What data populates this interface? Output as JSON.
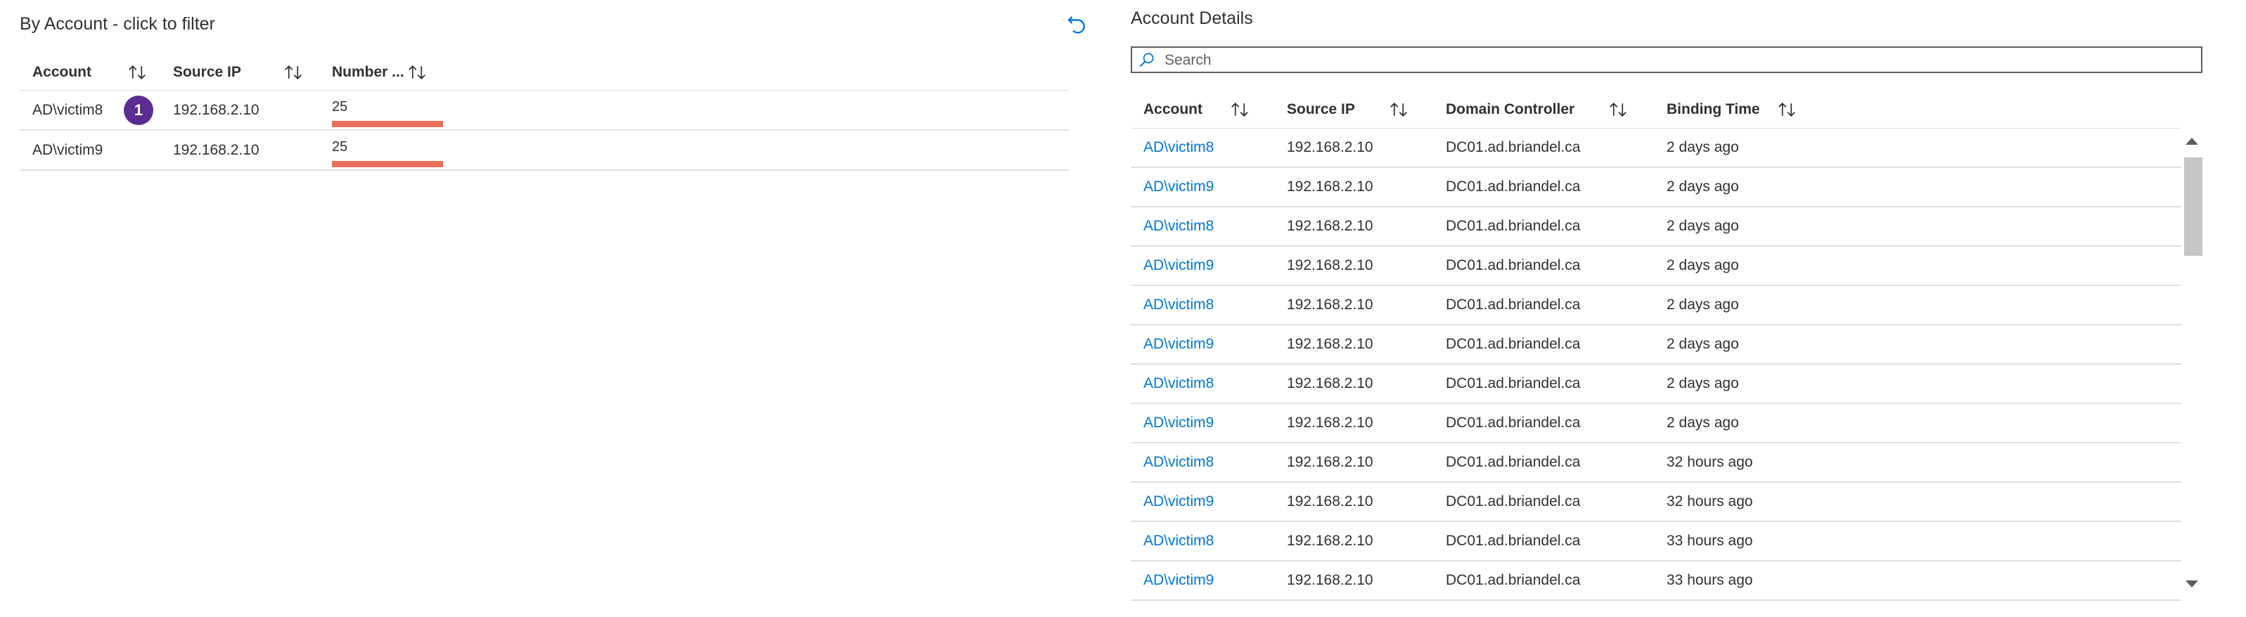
{
  "left": {
    "title": "By Account - click to filter",
    "columns": [
      "Account",
      "Source IP",
      "Number ..."
    ],
    "badge": "1",
    "bar_color": "#e8705c",
    "rows": [
      {
        "account": "AD\\victim8",
        "source_ip": "192.168.2.10",
        "number": "25",
        "bar_fraction": 1.0
      },
      {
        "account": "AD\\victim9",
        "source_ip": "192.168.2.10",
        "number": "25",
        "bar_fraction": 1.0
      }
    ],
    "icons": {
      "undo": "undo-icon",
      "sort": "sort-icon"
    }
  },
  "right": {
    "title": "Account Details",
    "search_placeholder": "Search",
    "columns": [
      "Account",
      "Source IP",
      "Domain Controller",
      "Binding Time"
    ],
    "link_color": "#0078d4",
    "rows": [
      {
        "account": "AD\\victim8",
        "source_ip": "192.168.2.10",
        "dc": "DC01.ad.briandel.ca",
        "time": "2 days ago"
      },
      {
        "account": "AD\\victim9",
        "source_ip": "192.168.2.10",
        "dc": "DC01.ad.briandel.ca",
        "time": "2 days ago"
      },
      {
        "account": "AD\\victim8",
        "source_ip": "192.168.2.10",
        "dc": "DC01.ad.briandel.ca",
        "time": "2 days ago"
      },
      {
        "account": "AD\\victim9",
        "source_ip": "192.168.2.10",
        "dc": "DC01.ad.briandel.ca",
        "time": "2 days ago"
      },
      {
        "account": "AD\\victim8",
        "source_ip": "192.168.2.10",
        "dc": "DC01.ad.briandel.ca",
        "time": "2 days ago"
      },
      {
        "account": "AD\\victim9",
        "source_ip": "192.168.2.10",
        "dc": "DC01.ad.briandel.ca",
        "time": "2 days ago"
      },
      {
        "account": "AD\\victim8",
        "source_ip": "192.168.2.10",
        "dc": "DC01.ad.briandel.ca",
        "time": "2 days ago"
      },
      {
        "account": "AD\\victim9",
        "source_ip": "192.168.2.10",
        "dc": "DC01.ad.briandel.ca",
        "time": "2 days ago"
      },
      {
        "account": "AD\\victim8",
        "source_ip": "192.168.2.10",
        "dc": "DC01.ad.briandel.ca",
        "time": "32 hours ago"
      },
      {
        "account": "AD\\victim9",
        "source_ip": "192.168.2.10",
        "dc": "DC01.ad.briandel.ca",
        "time": "32 hours ago"
      },
      {
        "account": "AD\\victim8",
        "source_ip": "192.168.2.10",
        "dc": "DC01.ad.briandel.ca",
        "time": "33 hours ago"
      },
      {
        "account": "AD\\victim9",
        "source_ip": "192.168.2.10",
        "dc": "DC01.ad.briandel.ca",
        "time": "33 hours ago"
      }
    ]
  }
}
